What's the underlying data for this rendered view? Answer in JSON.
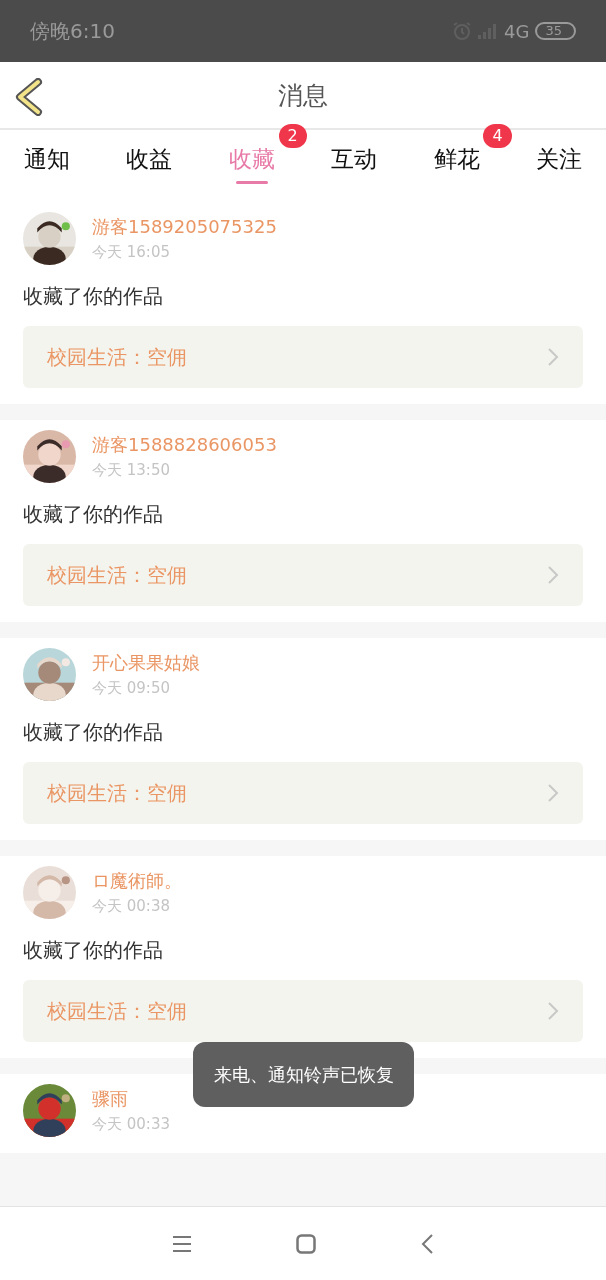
{
  "status_bar": {
    "time": "傍晚6:10",
    "network": "4G",
    "battery": "35"
  },
  "header": {
    "title": "消息"
  },
  "tabs": [
    {
      "label": "通知",
      "selected": false
    },
    {
      "label": "收益",
      "selected": false
    },
    {
      "label": "收藏",
      "selected": true,
      "badge": "2"
    },
    {
      "label": "互动",
      "selected": false
    },
    {
      "label": "鲜花",
      "selected": false,
      "badge": "4"
    },
    {
      "label": "关注",
      "selected": false
    }
  ],
  "messages": [
    {
      "user": "游客1589205075325",
      "time": "今天 16:05",
      "action": "收藏了你的作品",
      "work": "校园生活：空佣"
    },
    {
      "user": "游客1588828606053",
      "time": "今天 13:50",
      "action": "收藏了你的作品",
      "work": "校园生活：空佣"
    },
    {
      "user": "开心果果姑娘",
      "time": "今天 09:50",
      "action": "收藏了你的作品",
      "work": "校园生活：空佣"
    },
    {
      "user": "ロ魔術師。",
      "time": "今天 00:38",
      "action": "收藏了你的作品",
      "work": "校园生活：空佣"
    },
    {
      "user": "骤雨",
      "time": "今天 00:33"
    }
  ],
  "toast": {
    "text": "来电、通知铃声已恢复"
  }
}
